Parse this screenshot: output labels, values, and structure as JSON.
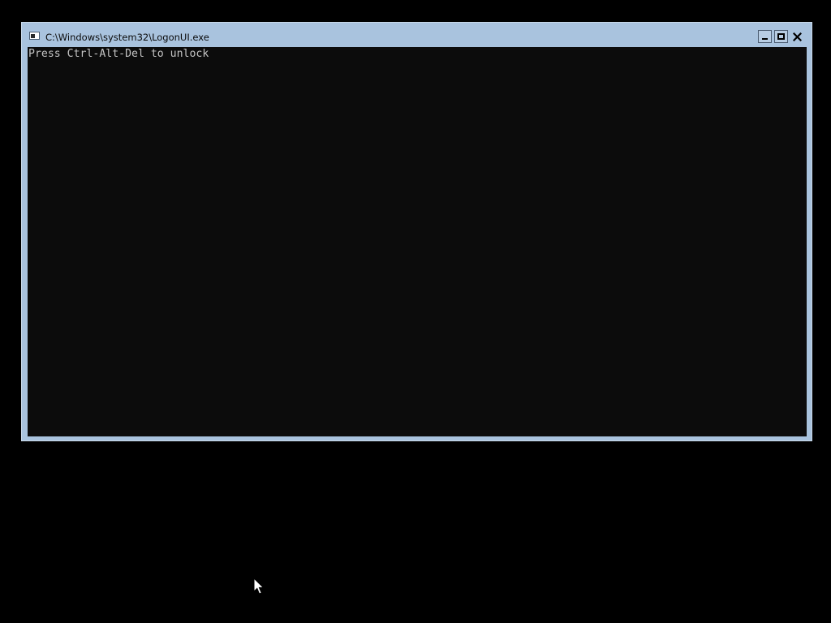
{
  "window": {
    "title": "C:\\Windows\\system32\\LogonUI.exe",
    "icon": "console-icon",
    "controls": {
      "minimize_icon": "minimize-icon",
      "maximize_icon": "maximize-icon",
      "close_icon": "close-icon"
    }
  },
  "console": {
    "lines": [
      "Press Ctrl-Alt-Del to unlock"
    ]
  },
  "colors": {
    "desktop_background": "#000000",
    "window_frame": "#a9c3de",
    "console_background": "#0c0c0c",
    "console_text": "#c4c4c4"
  },
  "cursor": {
    "icon": "arrow-cursor-icon"
  }
}
